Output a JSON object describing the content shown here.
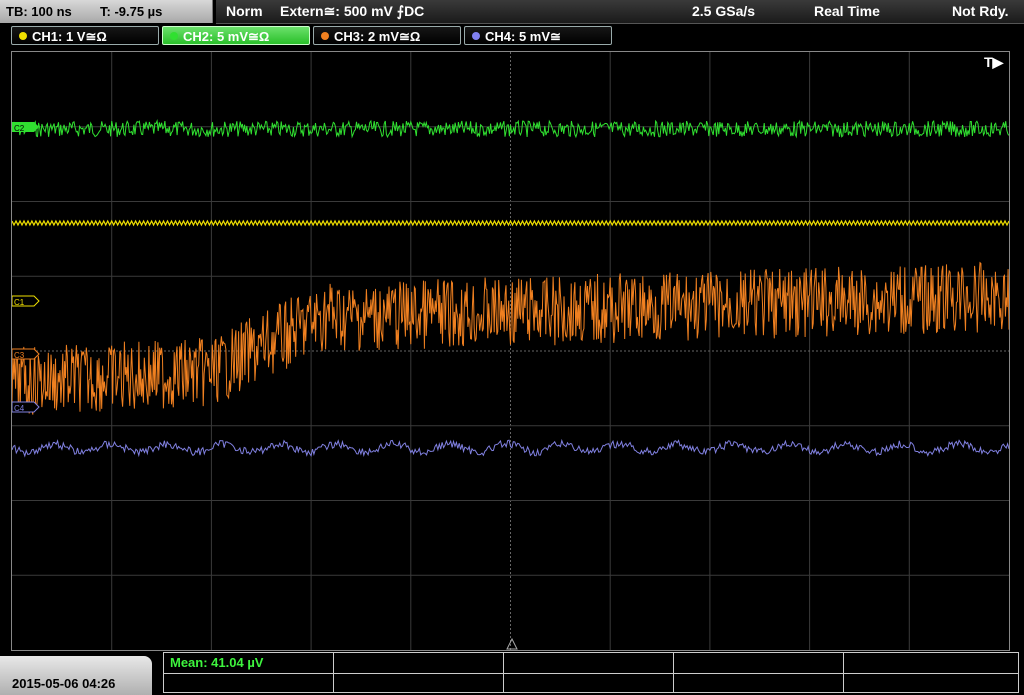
{
  "header": {
    "timebase": "TB: 100 ns",
    "trigger_time": "T: -9.75 µs",
    "mode": "Norm",
    "trigger_source": "Extern≅: 500 mV ⨍DC",
    "sample_rate": "2.5 GSa/s",
    "acq_mode": "Real Time",
    "status": "Not Rdy."
  },
  "channels": [
    {
      "label": "CH1: 1 V≅Ω",
      "color": "#f0e000",
      "active": false
    },
    {
      "label": "CH2: 5 mV≅Ω",
      "color": "#30e030",
      "active": true
    },
    {
      "label": "CH3: 2 mV≅Ω",
      "color": "#f08020",
      "active": false
    },
    {
      "label": "CH4: 5 mV≅",
      "color": "#8080f0",
      "active": false
    }
  ],
  "markers": {
    "trigger": "T▶",
    "c1": "C1",
    "c2": "C2",
    "c3": "C3",
    "c4": "C4"
  },
  "measurement": {
    "label": "Mean: 41.04 µV"
  },
  "datetime": "2015-05-06 04:26",
  "colors": {
    "ch1": "#f0e000",
    "ch2": "#30e030",
    "ch3": "#f08020",
    "ch4": "#8080e0"
  }
}
